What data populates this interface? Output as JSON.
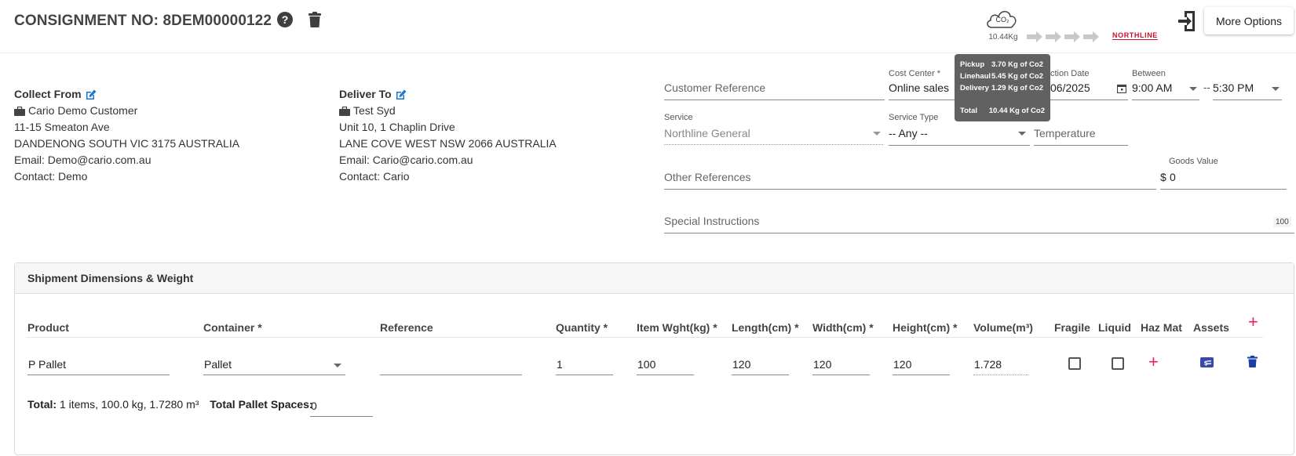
{
  "header": {
    "title": "CONSIGNMENT NO: 8DEM00000122",
    "co2_icon_text": "CO₂",
    "co2_total": "10.44Kg",
    "carrier_logo": "NORTHLINE",
    "more_options": "More Options",
    "icons": [
      "help-icon",
      "trash-icon",
      "co2-cloud-icon",
      "arrow-chain-icon",
      "export-icon"
    ]
  },
  "tooltip": {
    "rows": [
      {
        "label": "Pickup",
        "value": "3.70 Kg of Co2"
      },
      {
        "label": "Linehaul",
        "value": "5.45 Kg of Co2"
      },
      {
        "label": "Delivery",
        "value": "1.29 Kg of Co2"
      }
    ],
    "total_label": "Total",
    "total_value": "10.44 Kg of Co2"
  },
  "collect_from": {
    "label": "Collect From",
    "company": "Cario Demo Customer",
    "address1": "11-15 Smeaton Ave",
    "address2": "DANDENONG SOUTH VIC 3175 AUSTRALIA",
    "email": "Email: Demo@cario.com.au",
    "contact": "Contact: Demo"
  },
  "deliver_to": {
    "label": "Deliver To",
    "company": "Test Syd",
    "address1": "Unit 10, 1 Chaplin Drive",
    "address2": "LANE COVE WEST NSW 2066 AUSTRALIA",
    "email": "Email: Cario@cario.com.au",
    "contact": "Contact: Cario"
  },
  "form": {
    "customer_reference": {
      "placeholder": "Customer Reference"
    },
    "cost_center": {
      "label": "Cost Center *",
      "value": "Online sales"
    },
    "collection_date": {
      "label": "ction Date",
      "value": "06/2025"
    },
    "between": {
      "label": "Between",
      "from": "9:00 AM",
      "to_prefix": "--",
      "to": "5:30 PM"
    },
    "service": {
      "label": "Service",
      "value": "Northline General"
    },
    "service_type": {
      "label": "Service Type",
      "value": "-- Any --"
    },
    "temperature": {
      "placeholder": "Temperature"
    },
    "other_references": {
      "placeholder": "Other References"
    },
    "goods_value": {
      "label": "Goods Value",
      "prefix": "$",
      "value": "0"
    },
    "special_instructions": {
      "placeholder": "Special Instructions",
      "counter": "100"
    }
  },
  "shipment": {
    "title": "Shipment Dimensions & Weight",
    "columns": [
      "Product",
      "Container *",
      "Reference",
      "Quantity *",
      "Item Wght(kg) *",
      "Length(cm) *",
      "Width(cm) *",
      "Height(cm) *",
      "Volume(m³)",
      "Fragile",
      "Liquid",
      "Haz Mat",
      "Assets"
    ],
    "row": {
      "product": "P Pallet",
      "container": "Pallet",
      "reference": "",
      "quantity": "1",
      "weight": "100",
      "length": "120",
      "width": "120",
      "height": "120",
      "volume": "1.728",
      "fragile": false,
      "liquid": false
    },
    "totals_label": "Total:",
    "totals_value": "1 items, 100.0 kg, 1.7280 m³",
    "pallet_label": "Total Pallet Spaces:",
    "pallet_value": "0"
  }
}
